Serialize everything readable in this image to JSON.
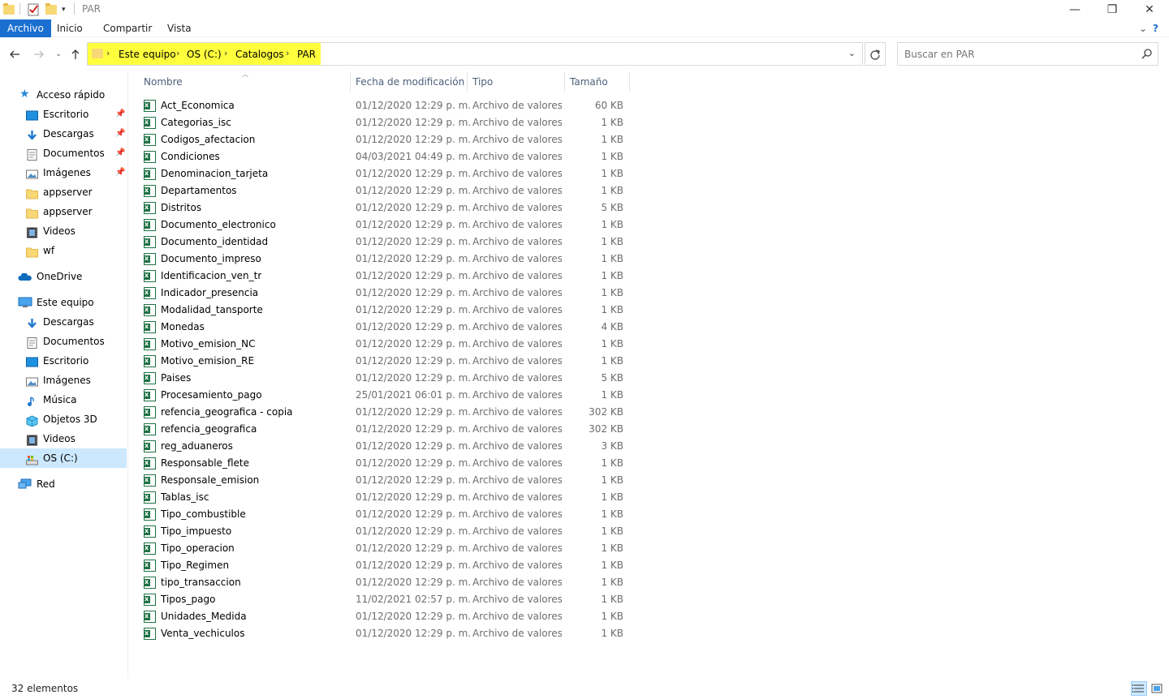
{
  "window": {
    "title": "PAR",
    "minimize": "—",
    "restore": "❐",
    "close": "✕"
  },
  "ribbon": {
    "tabs": [
      "Archivo",
      "Inicio",
      "Compartir",
      "Vista"
    ],
    "expand": "⌄",
    "help": "?"
  },
  "address": {
    "crumbs": [
      "Este equipo",
      "OS (C:)",
      "Catalogos",
      "PAR"
    ],
    "highlight_color": "#ffff3d"
  },
  "search": {
    "placeholder": "Buscar en PAR"
  },
  "nav": {
    "quick_access": "Acceso rápido",
    "quick_items": [
      {
        "label": "Escritorio",
        "icon": "desktop-icon",
        "pinned": true
      },
      {
        "label": "Descargas",
        "icon": "download-icon",
        "pinned": true
      },
      {
        "label": "Documentos",
        "icon": "documents-icon",
        "pinned": true
      },
      {
        "label": "Imágenes",
        "icon": "pictures-icon",
        "pinned": true
      },
      {
        "label": "appserver",
        "icon": "folder-icon",
        "pinned": false
      },
      {
        "label": "appserver",
        "icon": "folder-icon",
        "pinned": false
      },
      {
        "label": "Videos",
        "icon": "videos-icon",
        "pinned": false
      },
      {
        "label": "wf",
        "icon": "folder-icon",
        "pinned": false
      }
    ],
    "onedrive": "OneDrive",
    "this_pc": "Este equipo",
    "pc_items": [
      {
        "label": "Descargas",
        "icon": "download-icon"
      },
      {
        "label": "Documentos",
        "icon": "documents-icon"
      },
      {
        "label": "Escritorio",
        "icon": "desktop-icon"
      },
      {
        "label": "Imágenes",
        "icon": "pictures-icon"
      },
      {
        "label": "Música",
        "icon": "music-icon"
      },
      {
        "label": "Objetos 3D",
        "icon": "3d-objects-icon"
      },
      {
        "label": "Videos",
        "icon": "videos-icon"
      },
      {
        "label": "OS (C:)",
        "icon": "drive-icon",
        "selected": true
      }
    ],
    "network": "Red"
  },
  "columns": {
    "name": "Nombre",
    "date": "Fecha de modificación",
    "type": "Tipo",
    "size": "Tamaño"
  },
  "files": [
    {
      "name": "Act_Economica",
      "date": "01/12/2020 12:29 p. m.",
      "type": "Archivo de valores...",
      "size": "60 KB"
    },
    {
      "name": "Categorias_isc",
      "date": "01/12/2020 12:29 p. m.",
      "type": "Archivo de valores...",
      "size": "1 KB"
    },
    {
      "name": "Codigos_afectacion",
      "date": "01/12/2020 12:29 p. m.",
      "type": "Archivo de valores...",
      "size": "1 KB"
    },
    {
      "name": "Condiciones",
      "date": "04/03/2021 04:49 p. m.",
      "type": "Archivo de valores...",
      "size": "1 KB"
    },
    {
      "name": "Denominacion_tarjeta",
      "date": "01/12/2020 12:29 p. m.",
      "type": "Archivo de valores...",
      "size": "1 KB"
    },
    {
      "name": "Departamentos",
      "date": "01/12/2020 12:29 p. m.",
      "type": "Archivo de valores...",
      "size": "1 KB"
    },
    {
      "name": "Distritos",
      "date": "01/12/2020 12:29 p. m.",
      "type": "Archivo de valores...",
      "size": "5 KB"
    },
    {
      "name": "Documento_electronico",
      "date": "01/12/2020 12:29 p. m.",
      "type": "Archivo de valores...",
      "size": "1 KB"
    },
    {
      "name": "Documento_identidad",
      "date": "01/12/2020 12:29 p. m.",
      "type": "Archivo de valores...",
      "size": "1 KB"
    },
    {
      "name": "Documento_impreso",
      "date": "01/12/2020 12:29 p. m.",
      "type": "Archivo de valores...",
      "size": "1 KB"
    },
    {
      "name": "Identificacion_ven_tr",
      "date": "01/12/2020 12:29 p. m.",
      "type": "Archivo de valores...",
      "size": "1 KB"
    },
    {
      "name": "Indicador_presencia",
      "date": "01/12/2020 12:29 p. m.",
      "type": "Archivo de valores...",
      "size": "1 KB"
    },
    {
      "name": "Modalidad_tansporte",
      "date": "01/12/2020 12:29 p. m.",
      "type": "Archivo de valores...",
      "size": "1 KB"
    },
    {
      "name": "Monedas",
      "date": "01/12/2020 12:29 p. m.",
      "type": "Archivo de valores...",
      "size": "4 KB"
    },
    {
      "name": "Motivo_emision_NC",
      "date": "01/12/2020 12:29 p. m.",
      "type": "Archivo de valores...",
      "size": "1 KB"
    },
    {
      "name": "Motivo_emision_RE",
      "date": "01/12/2020 12:29 p. m.",
      "type": "Archivo de valores...",
      "size": "1 KB"
    },
    {
      "name": "Paises",
      "date": "01/12/2020 12:29 p. m.",
      "type": "Archivo de valores...",
      "size": "5 KB"
    },
    {
      "name": "Procesamiento_pago",
      "date": "25/01/2021 06:01 p. m.",
      "type": "Archivo de valores...",
      "size": "1 KB"
    },
    {
      "name": "refencia_geografica - copia",
      "date": "01/12/2020 12:29 p. m.",
      "type": "Archivo de valores...",
      "size": "302 KB"
    },
    {
      "name": "refencia_geografica",
      "date": "01/12/2020 12:29 p. m.",
      "type": "Archivo de valores...",
      "size": "302 KB"
    },
    {
      "name": "reg_aduaneros",
      "date": "01/12/2020 12:29 p. m.",
      "type": "Archivo de valores...",
      "size": "3 KB"
    },
    {
      "name": "Responsable_flete",
      "date": "01/12/2020 12:29 p. m.",
      "type": "Archivo de valores...",
      "size": "1 KB"
    },
    {
      "name": "Responsale_emision",
      "date": "01/12/2020 12:29 p. m.",
      "type": "Archivo de valores...",
      "size": "1 KB"
    },
    {
      "name": "Tablas_isc",
      "date": "01/12/2020 12:29 p. m.",
      "type": "Archivo de valores...",
      "size": "1 KB"
    },
    {
      "name": "Tipo_combustible",
      "date": "01/12/2020 12:29 p. m.",
      "type": "Archivo de valores...",
      "size": "1 KB"
    },
    {
      "name": "Tipo_impuesto",
      "date": "01/12/2020 12:29 p. m.",
      "type": "Archivo de valores...",
      "size": "1 KB"
    },
    {
      "name": "Tipo_operacion",
      "date": "01/12/2020 12:29 p. m.",
      "type": "Archivo de valores...",
      "size": "1 KB"
    },
    {
      "name": "Tipo_Regimen",
      "date": "01/12/2020 12:29 p. m.",
      "type": "Archivo de valores...",
      "size": "1 KB"
    },
    {
      "name": "tipo_transaccion",
      "date": "01/12/2020 12:29 p. m.",
      "type": "Archivo de valores...",
      "size": "1 KB"
    },
    {
      "name": "Tipos_pago",
      "date": "11/02/2021 02:57 p. m.",
      "type": "Archivo de valores...",
      "size": "1 KB"
    },
    {
      "name": "Unidades_Medida",
      "date": "01/12/2020 12:29 p. m.",
      "type": "Archivo de valores...",
      "size": "1 KB"
    },
    {
      "name": "Venta_vechiculos",
      "date": "01/12/2020 12:29 p. m.",
      "type": "Archivo de valores...",
      "size": "1 KB"
    }
  ],
  "status": {
    "count": "32 elementos"
  }
}
